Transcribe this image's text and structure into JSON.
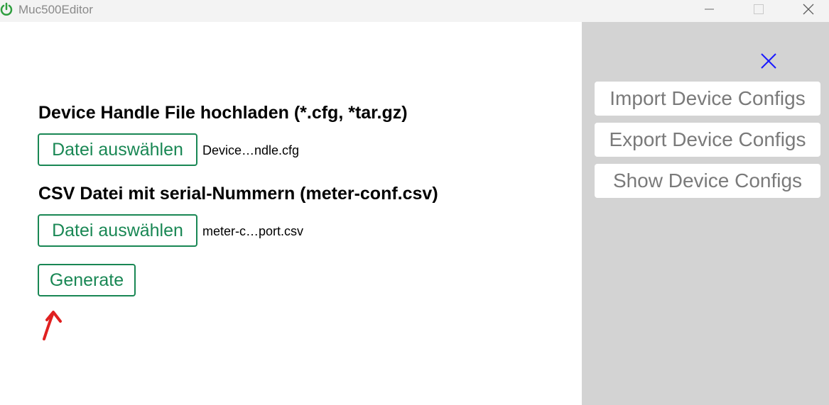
{
  "window": {
    "title": "Muc500Editor"
  },
  "main": {
    "handle_heading": "Device Handle File hochladen (*.cfg, *tar.gz)",
    "handle_button_label": "Datei auswählen",
    "handle_file_name": "Device…ndle.cfg",
    "csv_heading": "CSV Datei mit serial-Nummern (meter-conf.csv)",
    "csv_button_label": "Datei auswählen",
    "csv_file_name": "meter-c…port.csv",
    "generate_label": "Generate"
  },
  "side_panel": {
    "import_label": "Import Device Configs",
    "export_label": "Export Device Configs",
    "show_label": "Show Device Configs"
  },
  "colors": {
    "accent_green": "#198754",
    "panel_bg": "#d3d3d3",
    "close_blue": "#1a1aff",
    "annotation_red": "#e02020"
  },
  "icons": [
    "app-power-icon",
    "minimize-icon",
    "maximize-icon",
    "window-close-icon",
    "panel-close-icon",
    "annotation-arrow-icon"
  ]
}
